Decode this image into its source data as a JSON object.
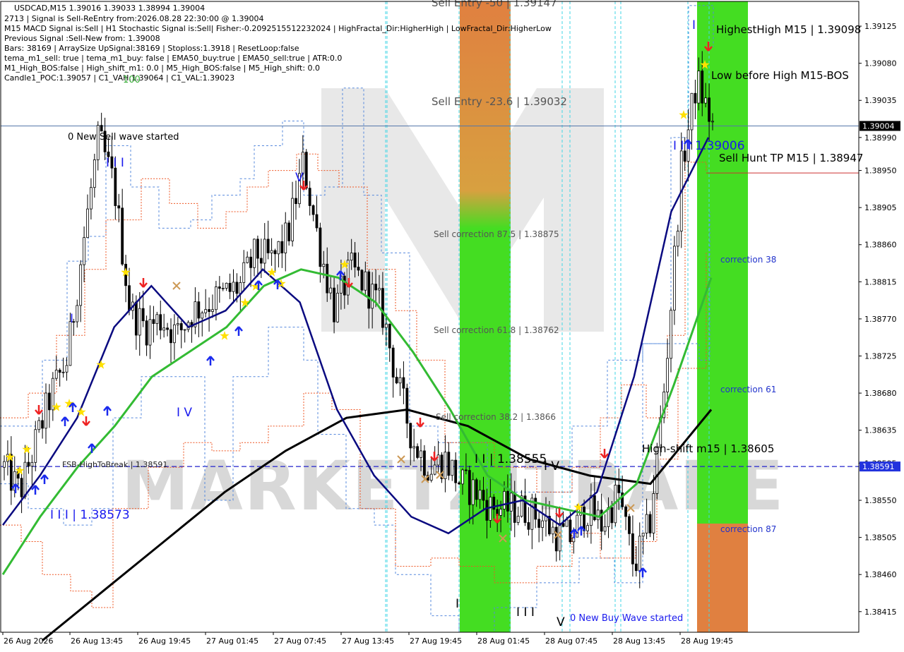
{
  "chart_data": {
    "type": "candlestick",
    "symbol_title": "USDCAD,M15  1.39016 1.39033 1.38994 1.39004",
    "info_lines": [
      "2713 | Signal is Sell-ReEntry from:2026.08.28 22:30:00 @ 1.39004",
      "M15 MACD Signal is:Sell | H1 Stochastic Signal is:Sell| Fisher:-0.2092515512232024 | HighFractal_Dir:HigherHigh | LowFractal_Dir:HigherLow",
      "Previous Signal :Sell-New from: 1.39008",
      "Bars: 38169 | ArraySize UpSignal:38169 | Stoploss:1.3918 | ResetLoop:false",
      "tema_m1_sell: true | tema_m1_buy: false | EMA50_buy:true | EMA50_sell:true | ATR:0.0",
      "M1_High_BOS:false | High_shift_m1: 0.0 | M5_High_BOS:false | M5_High_shift: 0.0",
      "Candle1_POC:1.39057 | C1_VAH:1.39064 | C1_VAL:1.39023"
    ],
    "top_marker": "100",
    "y_ticks": [
      "1.39125",
      "1.39080",
      "1.39035",
      "1.38990",
      "1.38950",
      "1.38905",
      "1.38860",
      "1.38815",
      "1.38770",
      "1.38725",
      "1.38680",
      "1.38635",
      "1.38595",
      "1.38550",
      "1.38505",
      "1.38460",
      "1.38415"
    ],
    "ylim": [
      1.3839,
      1.39155
    ],
    "x_ticks": [
      "26 Aug 2026",
      "26 Aug 13:45",
      "26 Aug 19:45",
      "27 Aug 01:45",
      "27 Aug 07:45",
      "27 Aug 13:45",
      "27 Aug 19:45",
      "28 Aug 01:45",
      "28 Aug 07:45",
      "28 Aug 13:45",
      "28 Aug 19:45"
    ],
    "current_price": "1.39004",
    "fsb_price": "1.38591",
    "watermark": "MARKETZITRADE",
    "zone_labels": {
      "sell_entry_50": "Sell Entry -50 | 1.39147",
      "sell_entry_236": "Sell Entry -23.6 | 1.39032",
      "sell_corr_875": "Sell correction 87.5 | 1.38875",
      "sell_corr_618": "Sell correction 61.8 | 1.38762",
      "sell_corr_382": "Sell correction 38.2 | 1.3866",
      "corr_38": "correction 38",
      "corr_61": "correction 61",
      "corr_87": "correction 87"
    },
    "annotations": {
      "new_sell_wave": "0 New Sell wave started",
      "new_buy_wave": "0 New Buy Wave started",
      "fsb": "FSB-HighToBreak | 1.38591",
      "highest_high": "HighestHigh   M15 | 1.39098",
      "low_before_high": "Low before High   M15-BOS",
      "sell_hunt_tp": "Sell Hunt TP M15 | 1.38947",
      "high_shift": "High-shift m15 | 1.38605",
      "w_iii_38573": "I I I | 1.38573",
      "w_ii_38555": "I I | 1.38555",
      "w_iii_39006": "I I I 1.39006",
      "w_iii_top": "I I I",
      "w_i_left": "I",
      "w_iv_left": "I V",
      "w_v_top": "V",
      "w_iv_mid": "I V",
      "w_i_bottom": "I",
      "w_iii_bottom": "I I I",
      "w_v_bottom": "V",
      "w_i_right": "I"
    },
    "closes": [
      1.3859,
      1.3856,
      1.3862,
      1.3868,
      1.3872,
      1.3886,
      1.3899,
      1.3893,
      1.3878,
      1.3876,
      1.3877,
      1.3875,
      1.3878,
      1.3879,
      1.388,
      1.3881,
      1.3885,
      1.3884,
      1.3887,
      1.3896,
      1.3886,
      1.3878,
      1.3883,
      1.3881,
      1.3878,
      1.3869,
      1.3862,
      1.3859,
      1.386,
      1.3857,
      1.3856,
      1.3854,
      1.3854,
      1.3854,
      1.3853,
      1.3851,
      1.38505,
      1.3854,
      1.3852,
      1.3856,
      1.3847,
      1.3852,
      1.387,
      1.3895,
      1.3906,
      1.39004
    ],
    "emas": {
      "green": [
        1.3846,
        1.3853,
        1.3859,
        1.3864,
        1.387,
        1.3873,
        1.3876,
        1.3881,
        1.3883,
        1.3882,
        1.3879,
        1.3873,
        1.3866,
        1.3858,
        1.3855,
        1.3854,
        1.3853,
        1.3857,
        1.3869,
        1.3882
      ],
      "navy": [
        1.3852,
        1.3858,
        1.3865,
        1.3876,
        1.3881,
        1.3876,
        1.3878,
        1.3883,
        1.3879,
        1.3866,
        1.3858,
        1.3853,
        1.3851,
        1.3854,
        1.3855,
        1.3852,
        1.3856,
        1.387,
        1.389,
        1.3899
      ],
      "black": [
        1.3838,
        1.3844,
        1.385,
        1.3856,
        1.3861,
        1.3865,
        1.3866,
        1.3864,
        1.386,
        1.3858,
        1.3857,
        1.3866
      ],
      "colors": {
        "green": "#33bb33",
        "navy": "#0a0a80",
        "black": "#000000",
        "zone_green": "#44dd22",
        "zone_orange": "#e08040",
        "blue_label": "#1a1aee",
        "corr_blue": "#2233cc"
      }
    }
  }
}
